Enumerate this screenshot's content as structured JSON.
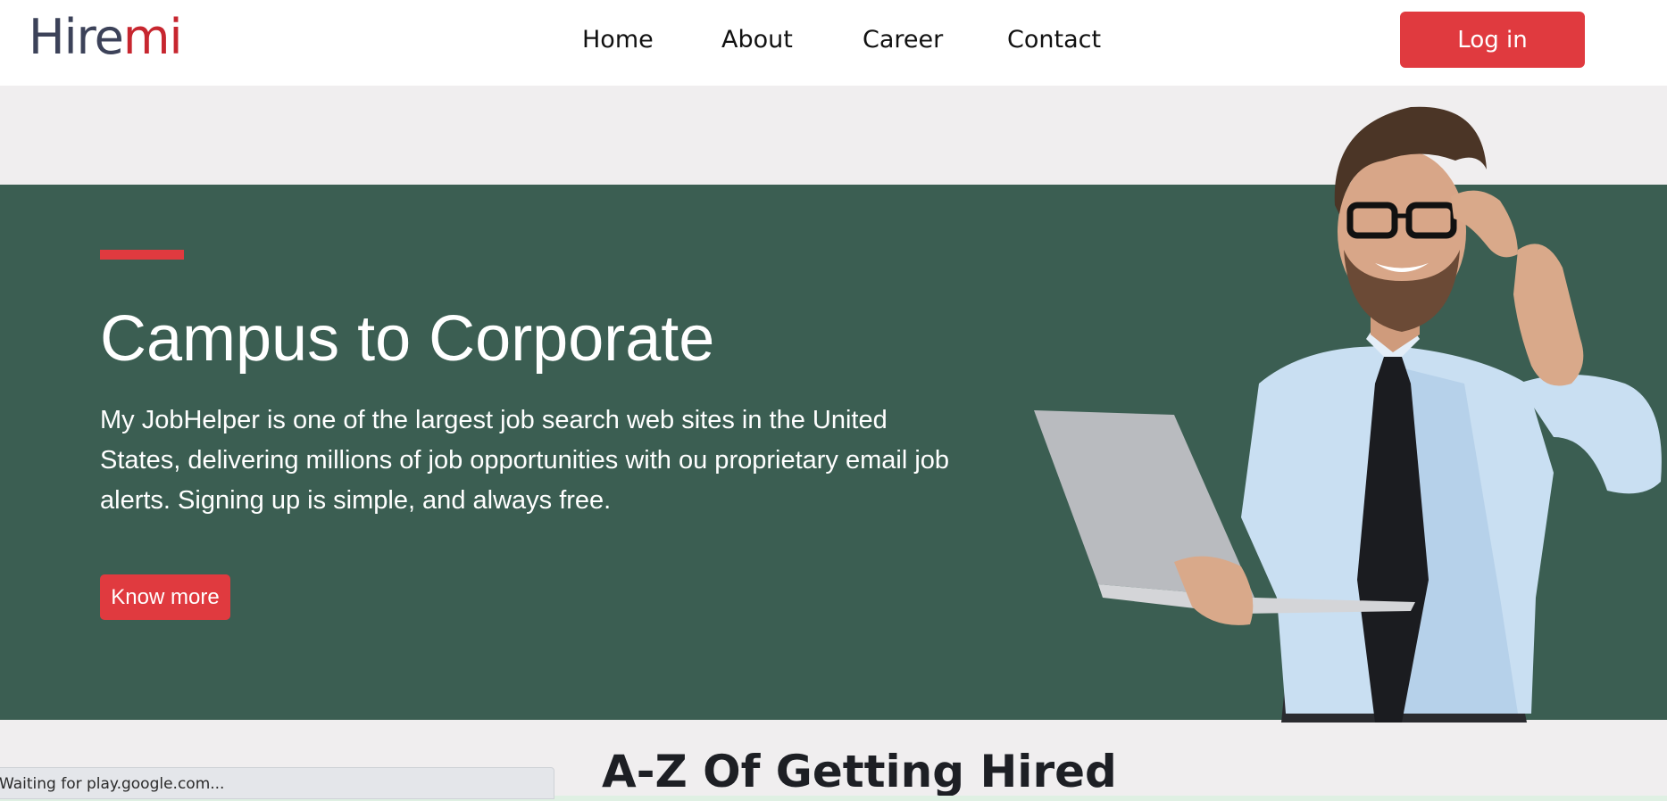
{
  "navbar": {
    "logo_part1": "Hire",
    "logo_part2": "mi",
    "links": [
      "Home",
      "About",
      "Career",
      "Contact"
    ],
    "login_label": "Log in"
  },
  "hero": {
    "title": "Campus to Corporate",
    "description": "My JobHelper is one of the largest job search web sites in the United States, delivering millions of job opportunities with ou proprietary email job alerts. Signing up is simple, and always free.",
    "button_label": "Know more"
  },
  "section": {
    "title": "A-Z Of Getting Hired"
  },
  "status": {
    "text": "Waiting for play.google.com..."
  },
  "colors": {
    "accent": "#e03a3f",
    "hero_bg": "#3b5e52",
    "logo_dark": "#3c4259",
    "logo_red": "#c7262f"
  }
}
